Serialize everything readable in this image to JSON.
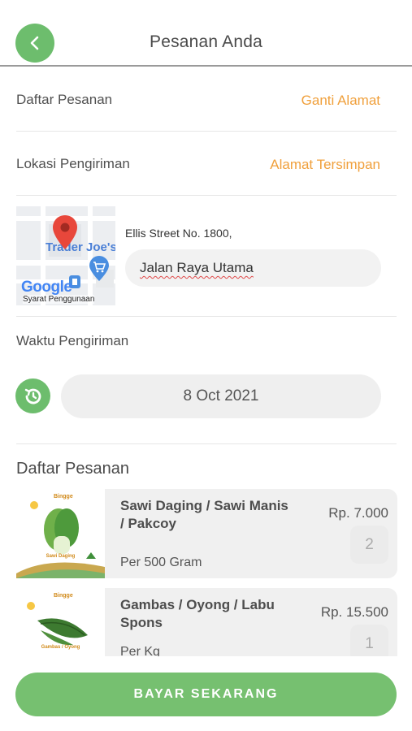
{
  "header": {
    "title": "Pesanan Anda",
    "back_icon": "chevron-left-icon",
    "accent": "#6dbd6d"
  },
  "order_row": {
    "label": "Daftar Pesanan",
    "link": "Ganti Alamat"
  },
  "location_row": {
    "label": "Lokasi Pengiriman",
    "link": "Alamat Tersimpan"
  },
  "map": {
    "place_label": "Trader Joe's",
    "logo": "Google",
    "caption": "Syarat Penggunaan"
  },
  "address": {
    "text": "Ellis Street No. 1800,",
    "input_value": "Jalan Raya Utama"
  },
  "delivery_time": {
    "label": "Waktu Pengiriman",
    "value": "8 Oct 2021",
    "icon": "history-icon"
  },
  "order_list": {
    "title": "Daftar Pesanan",
    "items": [
      {
        "name": "Sawi Daging / Sawi Manis / Pakcoy",
        "unit": "Per 500 Gram",
        "price": "Rp. 7.000",
        "qty": "2",
        "brand": "Bingge",
        "img_caption": "Sawi Daging"
      },
      {
        "name": "Gambas / Oyong / Labu Spons",
        "unit": "Per Kg",
        "price": "Rp. 15.500",
        "qty": "1",
        "brand": "Bingge",
        "img_caption": "Gambas / Oyong"
      }
    ]
  },
  "pay_button": {
    "label": "BAYAR SEKARANG",
    "color": "#76c070"
  },
  "colors": {
    "link": "#f0a03c",
    "pill_bg": "#efefef"
  }
}
